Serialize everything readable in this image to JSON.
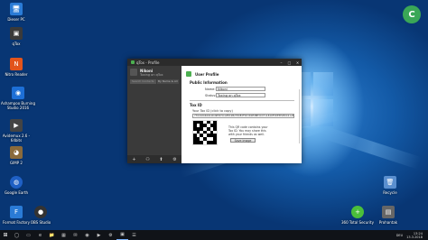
{
  "desktop": {
    "icons_left": [
      {
        "label": "Dieser PC",
        "glyph": "🖥",
        "color": "#2a7bd6"
      },
      {
        "label": "qTox",
        "glyph": "▣",
        "color": "#3a3a3a"
      },
      {
        "label": "Nitro Reader",
        "glyph": "N",
        "color": "#e2541b"
      },
      {
        "label": "Ashampoo Burning Studio 2016",
        "glyph": "◉",
        "color": "#1d6fd6"
      },
      {
        "label": "Avidemux 2.6 - 64bits",
        "glyph": "▶",
        "color": "#444"
      },
      {
        "label": "GIMP 2",
        "glyph": "◕",
        "color": "#8a6a3b"
      },
      {
        "label": "Google Earth",
        "glyph": "◍",
        "color": "#1f60c5"
      },
      {
        "label": "Format Factory",
        "glyph": "F",
        "color": "#2a7bd6"
      },
      {
        "label": "OBS Studio",
        "glyph": "●",
        "color": "#333"
      }
    ],
    "icons_right": [
      {
        "label": "Recycle",
        "glyph": "🗑",
        "color": "#5a8fcf"
      },
      {
        "label": "360 Total Security",
        "glyph": "+",
        "color": "#4bbf3a"
      },
      {
        "label": "Prohantak",
        "glyph": "▤",
        "color": "#666"
      }
    ],
    "corner_badge": "C"
  },
  "window": {
    "title": "qTox - Profile",
    "controls": [
      "–",
      "□",
      "✕"
    ],
    "left": {
      "profile_name": "Nikoni",
      "profile_status": "Toxing on qTox",
      "search_placeholder": "Search Contacts",
      "sort_label": "By Name & All",
      "footer_icons": [
        "+",
        "⚇",
        "⬆",
        "⚙"
      ]
    },
    "right": {
      "header_title": "User Profile",
      "section_public": "Public Information",
      "name_label": "Name:",
      "name_value": "Nikoni",
      "status_label": "Status:",
      "status_value": "Toxing on qTox",
      "tox_id_title": "Tox ID",
      "tox_id_hint": "Your Tox ID (click to copy)",
      "tox_id_value": "770C02046024D49E0C5CAE8C2B2780E2F5D3D0E9BE3CD71184CE5DE5E280C21AE5CE5C7BD1",
      "qr_text": "This QR code contains your Tox ID. You may share this with your friends as well.",
      "save_label": "Save image"
    }
  },
  "taskbar": {
    "start_glyph": "⊞",
    "icons": [
      "◯",
      "▭",
      "e",
      "📁",
      "▦",
      "✉",
      "◉",
      "▶",
      "⚙",
      "▣",
      "☰"
    ],
    "tray_text": "DEU",
    "time": "13:24",
    "date": "13.3.2018"
  }
}
